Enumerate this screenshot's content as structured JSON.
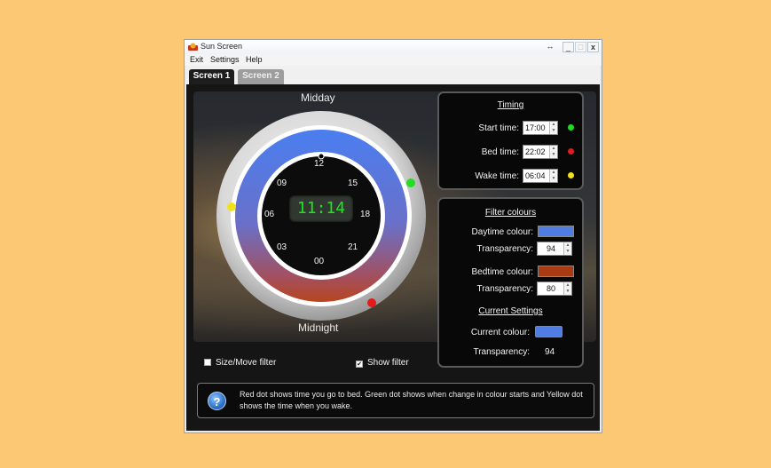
{
  "window": {
    "title": "Sun Screen",
    "resize_glyph": "↔",
    "minimize_glyph": "_",
    "maximize_glyph": "□",
    "close_glyph": "x"
  },
  "menu": [
    "Exit",
    "Settings",
    "Help"
  ],
  "tabs": [
    {
      "label": "Screen 1",
      "active": true
    },
    {
      "label": "Screen 2",
      "active": false
    }
  ],
  "clock": {
    "top_label": "Midday",
    "bottom_label": "Midnight",
    "digital_time": "11:14",
    "hours": [
      "12",
      "15",
      "18",
      "21",
      "00",
      "03",
      "06",
      "09"
    ]
  },
  "timing": {
    "heading": "Timing",
    "start": {
      "label": "Start time:",
      "value": "17:00",
      "dot_color": "#22dd22"
    },
    "bed": {
      "label": "Bed time:",
      "value": "22:02",
      "dot_color": "#e21b1b"
    },
    "wake": {
      "label": "Wake time:",
      "value": "06:04",
      "dot_color": "#f3e21a"
    }
  },
  "filter_colours": {
    "heading": "Filter colours",
    "daytime_label": "Daytime colour:",
    "daytime_color": "#4f7de3",
    "daytime_transparency_label": "Transparency:",
    "daytime_transparency": "94",
    "bedtime_label": "Bedtime colour:",
    "bedtime_color": "#a83a14",
    "bedtime_transparency_label": "Transparency:",
    "bedtime_transparency": "80"
  },
  "current_settings": {
    "heading": "Current Settings",
    "colour_label": "Current colour:",
    "colour": "#4f7de3",
    "transparency_label": "Transparency:",
    "transparency": "94"
  },
  "options": {
    "size_move_label": "Size/Move filter",
    "size_move_checked": false,
    "show_filter_label": "Show filter",
    "show_filter_checked": true
  },
  "info": {
    "icon": "question-icon",
    "text": "Red dot shows time you go to bed. Green dot shows when change in colour starts and Yellow dot shows the time when you wake."
  }
}
